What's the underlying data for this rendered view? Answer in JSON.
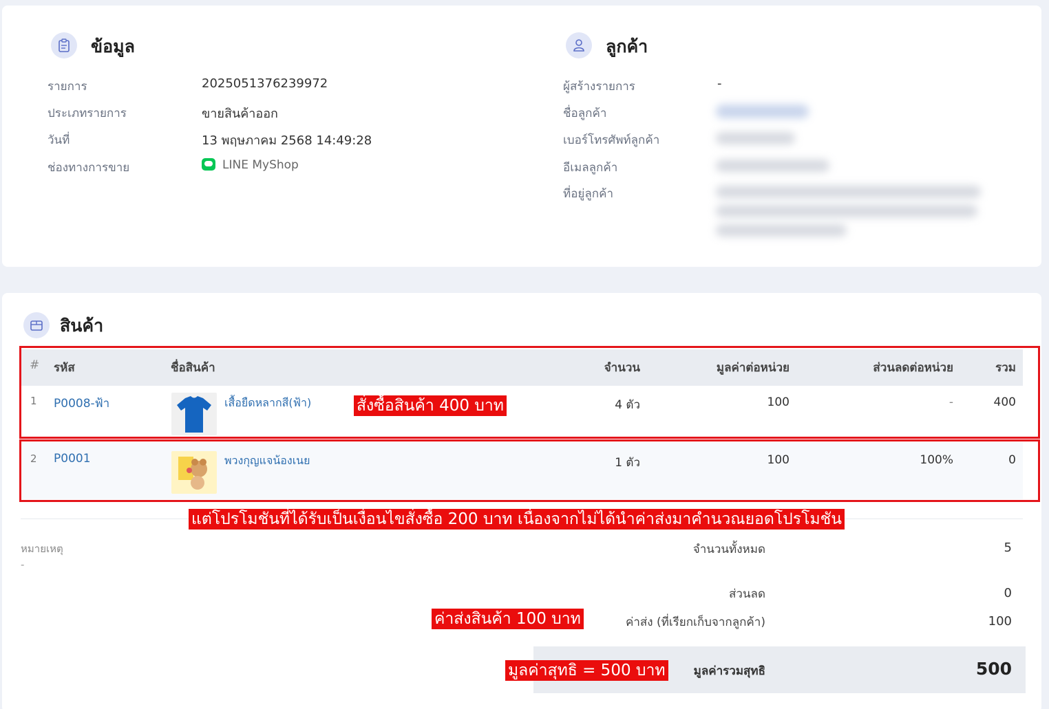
{
  "info": {
    "title": "ข้อมูล",
    "fields": [
      {
        "label": "รายการ",
        "value": "2025051376239972"
      },
      {
        "label": "ประเภทรายการ",
        "value": "ขายสินค้าออก"
      },
      {
        "label": "วันที่",
        "value": "13 พฤษภาคม 2568 14:49:28"
      },
      {
        "label": "ช่องทางการขาย",
        "value": "LINE MyShop"
      }
    ]
  },
  "customer": {
    "title": "ลูกค้า",
    "fields": [
      {
        "label": "ผู้สร้างรายการ",
        "value": "-"
      },
      {
        "label": "ชื่อลูกค้า"
      },
      {
        "label": "เบอร์โทรศัพท์ลูกค้า"
      },
      {
        "label": "อีเมลลูกค้า"
      },
      {
        "label": "ที่อยู่ลูกค้า"
      }
    ]
  },
  "products": {
    "title": "สินค้า",
    "columns": [
      "#",
      "รหัส",
      "ชื่อสินค้า",
      "จำนวน",
      "มูลค่าต่อหน่วย",
      "ส่วนลดต่อหน่วย",
      "รวม"
    ],
    "rows": [
      {
        "index": "1",
        "code": "P0008-ฟ้า",
        "name": "เสื้อยืดหลากสี(ฟ้า)",
        "qty": "4 ตัว",
        "unit_price": "100",
        "discount": "-",
        "total": "400"
      },
      {
        "index": "2",
        "code": "P0001",
        "name": "พวงกุญแจน้องเนย",
        "qty": "1 ตัว",
        "unit_price": "100",
        "discount": "100%",
        "total": "0"
      }
    ]
  },
  "note": {
    "label": "หมายเหตุ",
    "value": "-"
  },
  "summary": {
    "total_qty_label": "จำนวนทั้งหมด",
    "total_qty": "5",
    "discount_label": "ส่วนลด",
    "discount": "0",
    "shipping_label": "ค่าส่ง (ที่เรียกเก็บจากลูกค้า)",
    "shipping": "100",
    "net_label": "มูลค่ารวมสุทธิ",
    "net": "500"
  },
  "annotations": {
    "order": "สั่งซื้อสินค้า 400 บาท",
    "promo": "แต่โปรโมชันที่ได้รับเป็นเงื่อนไขสั่งซื้อ 200 บาท เนื่องจากไม่ได้นำค่าส่งมาคำนวณยอดโปรโมชัน",
    "shipping": "ค่าส่งสินค้า 100 บาท",
    "net": "มูลค่าสุทธิ = 500 บาท"
  },
  "colors": {
    "accent_link": "#2f6fb0",
    "annotation_red": "#ea0d0d",
    "line_green": "#06c755"
  }
}
